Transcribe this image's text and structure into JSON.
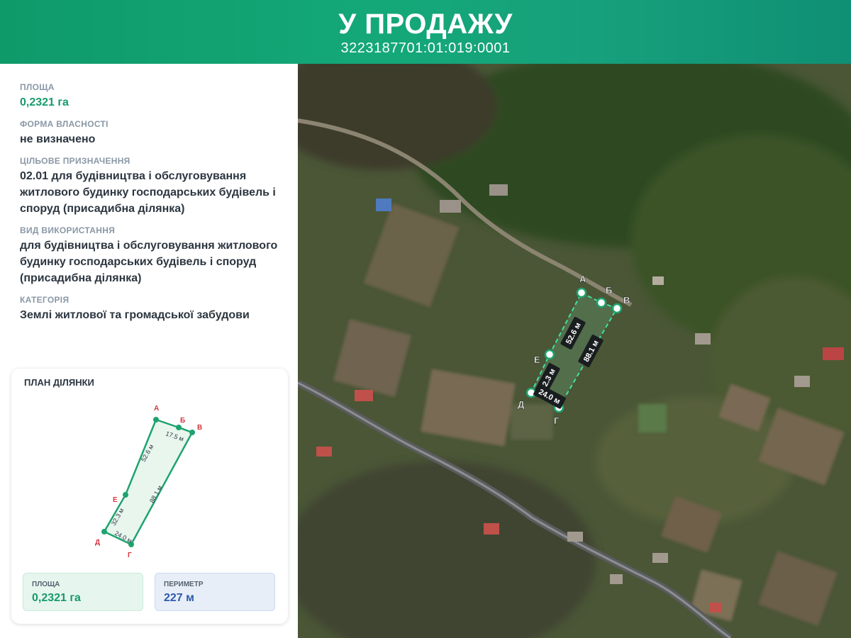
{
  "header": {
    "title": "У ПРОДАЖУ",
    "cadastral_number": "3223187701:01:019:0001"
  },
  "info": {
    "area": {
      "label": "ПЛОЩА",
      "value": "0,2321 га"
    },
    "ownership": {
      "label": "ФОРМА ВЛАСНОСТІ",
      "value": "не визначено"
    },
    "purpose": {
      "label": "ЦІЛЬОВЕ ПРИЗНАЧЕННЯ",
      "value": "02.01 для будівництва і обслуговування житлового будинку господарських будівель і споруд (присадибна ділянка)"
    },
    "usage": {
      "label": "ВИД ВИКОРИСТАННЯ",
      "value": "для будівництва і обслуговування житлового будинку господарських будівель і споруд (присадибна ділянка)"
    },
    "category": {
      "label": "КАТЕГОРІЯ",
      "value": "Землі житлової та громадської забудови"
    }
  },
  "plan": {
    "title": "ПЛАН ДІЛЯНКИ",
    "points": {
      "A": "А",
      "B": "Б",
      "V": "В",
      "G": "Г",
      "D": "Д",
      "E": "Е"
    },
    "segments": {
      "a_b": "17.5 м",
      "a_e": "52.6 м",
      "v_g": "88.1 м",
      "e_d": "32.3 м",
      "d_g": "24.0 м"
    },
    "area": {
      "label": "ПЛОЩА",
      "value": "0,2321 га"
    },
    "perimeter": {
      "label": "ПЕРИМЕТР",
      "value": "227 м"
    }
  },
  "map": {
    "points": {
      "A": "А",
      "B": "Б",
      "V": "В",
      "G": "Г",
      "D": "Д",
      "E": "Е"
    },
    "segments": {
      "a_e": "52.6 м",
      "v_g": "88.1 м",
      "e_d": "32.3 м",
      "d_g": "24.0 м"
    }
  },
  "colors": {
    "brand_green": "#169a6a",
    "point_label_red": "#d6353f",
    "perimeter_blue": "#2d5aa8"
  }
}
